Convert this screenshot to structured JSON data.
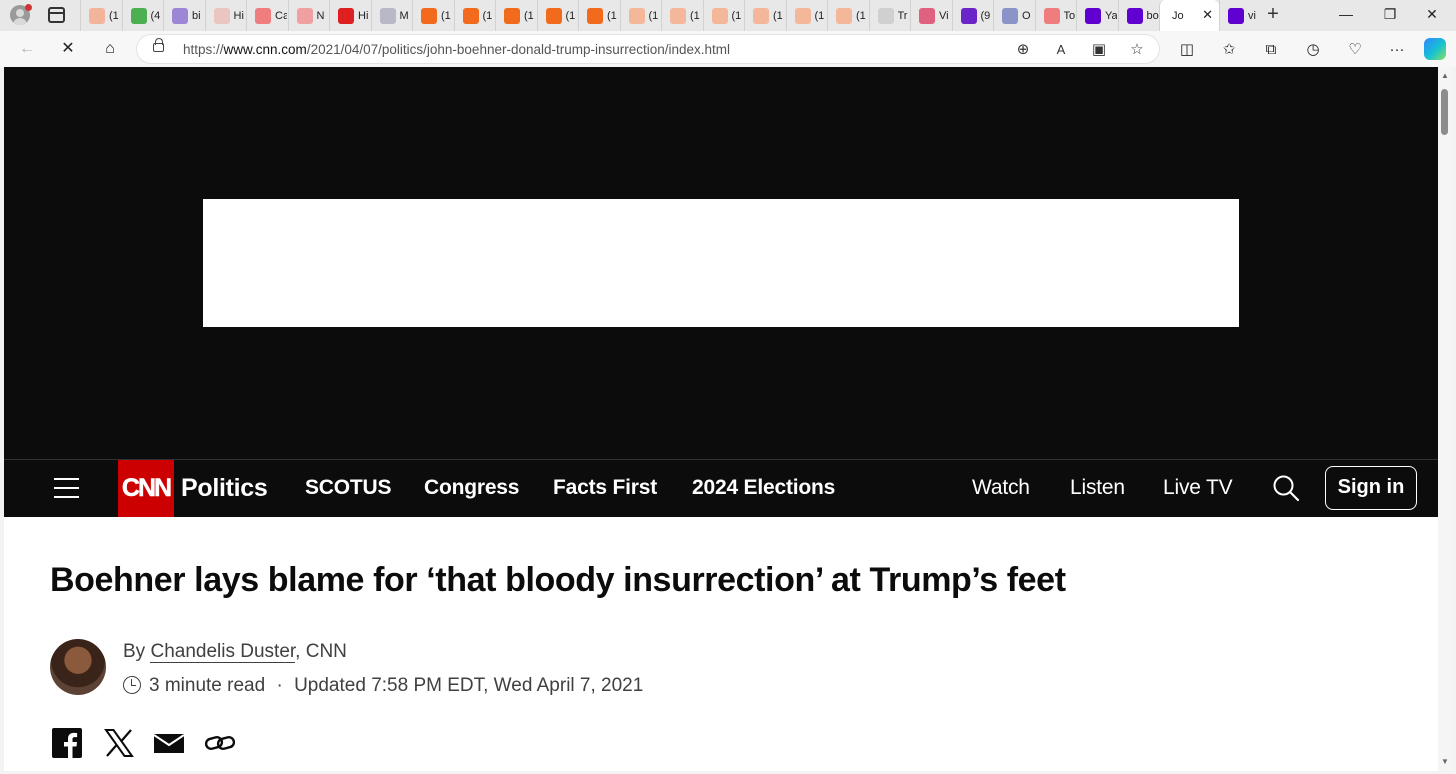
{
  "browser": {
    "tabs": [
      {
        "title": "(1",
        "favicon_color": "#f2b49b"
      },
      {
        "title": "(4",
        "favicon_color": "#4caf50"
      },
      {
        "title": "bi",
        "favicon_color": "#9b87d6"
      },
      {
        "title": "Hi",
        "favicon_color": "#e9c7c0"
      },
      {
        "title": "Ca",
        "favicon_color": "#f07d7d"
      },
      {
        "title": "N",
        "favicon_color": "#f0a0a0"
      },
      {
        "title": "Hi",
        "favicon_color": "#e02020"
      },
      {
        "title": "M",
        "favicon_color": "#b8b8c8"
      },
      {
        "title": "(1",
        "favicon_color": "#f26b1d"
      },
      {
        "title": "(1",
        "favicon_color": "#f26b1d"
      },
      {
        "title": "(1",
        "favicon_color": "#f26b1d"
      },
      {
        "title": "(1",
        "favicon_color": "#f26b1d"
      },
      {
        "title": "(1",
        "favicon_color": "#f26b1d"
      },
      {
        "title": "(1",
        "favicon_color": "#f5b79a"
      },
      {
        "title": "(1",
        "favicon_color": "#f5b79a"
      },
      {
        "title": "(1",
        "favicon_color": "#f5b79a"
      },
      {
        "title": "(1",
        "favicon_color": "#f5b79a"
      },
      {
        "title": "(1",
        "favicon_color": "#f5b79a"
      },
      {
        "title": "(1",
        "favicon_color": "#f5b79a"
      },
      {
        "title": "Tr",
        "favicon_color": "#d0d0d0"
      },
      {
        "title": "Vi",
        "favicon_color": "#e06080"
      },
      {
        "title": "(9",
        "favicon_color": "#6b24c8"
      },
      {
        "title": "O",
        "favicon_color": "#8a94c8"
      },
      {
        "title": "To",
        "favicon_color": "#f07d7d"
      },
      {
        "title": "Ya",
        "favicon_color": "#6001d2"
      },
      {
        "title": "bo",
        "favicon_color": "#6001d2"
      }
    ],
    "active_tab": {
      "title": "Jo"
    },
    "after_tab": {
      "title": "vi",
      "favicon_color": "#6001d2"
    },
    "url_prefix": "https://",
    "url_domain": "www.cnn.com",
    "url_path": "/2021/04/07/politics/john-boehner-donald-trump-insurrection/index.html"
  },
  "cnn_nav": {
    "logo_text": "CNN",
    "section": "Politics",
    "links": [
      "SCOTUS",
      "Congress",
      "Facts First",
      "2024 Elections"
    ],
    "right_links": [
      "Watch",
      "Listen",
      "Live TV"
    ],
    "sign_in": "Sign in"
  },
  "article": {
    "headline": "Boehner lays blame for ‘that bloody insurrection’ at Trump’s feet",
    "byline_prefix": "By",
    "author": "Chandelis Duster",
    "outlet": ", CNN",
    "read_time": "3 minute read",
    "separator": "·",
    "updated": "Updated 7:58 PM EDT, Wed April 7, 2021"
  },
  "colors": {
    "cnn_red": "#cc0000",
    "nav_bg": "#0c0c0c",
    "headline": "#0c0c0c",
    "byline": "#404040"
  },
  "icons": [
    "back-icon",
    "reload-icon",
    "home-icon",
    "lock-icon",
    "zoom-icon",
    "read-aloud-icon",
    "immersive-reader-icon",
    "favorite-star-icon",
    "split-screen-icon",
    "favorites-icon",
    "collections-icon",
    "history-icon",
    "health-icon",
    "more-icon",
    "copilot-icon",
    "hamburger-icon",
    "search-icon",
    "facebook-icon",
    "x-icon",
    "email-icon",
    "link-icon",
    "clock-icon"
  ]
}
